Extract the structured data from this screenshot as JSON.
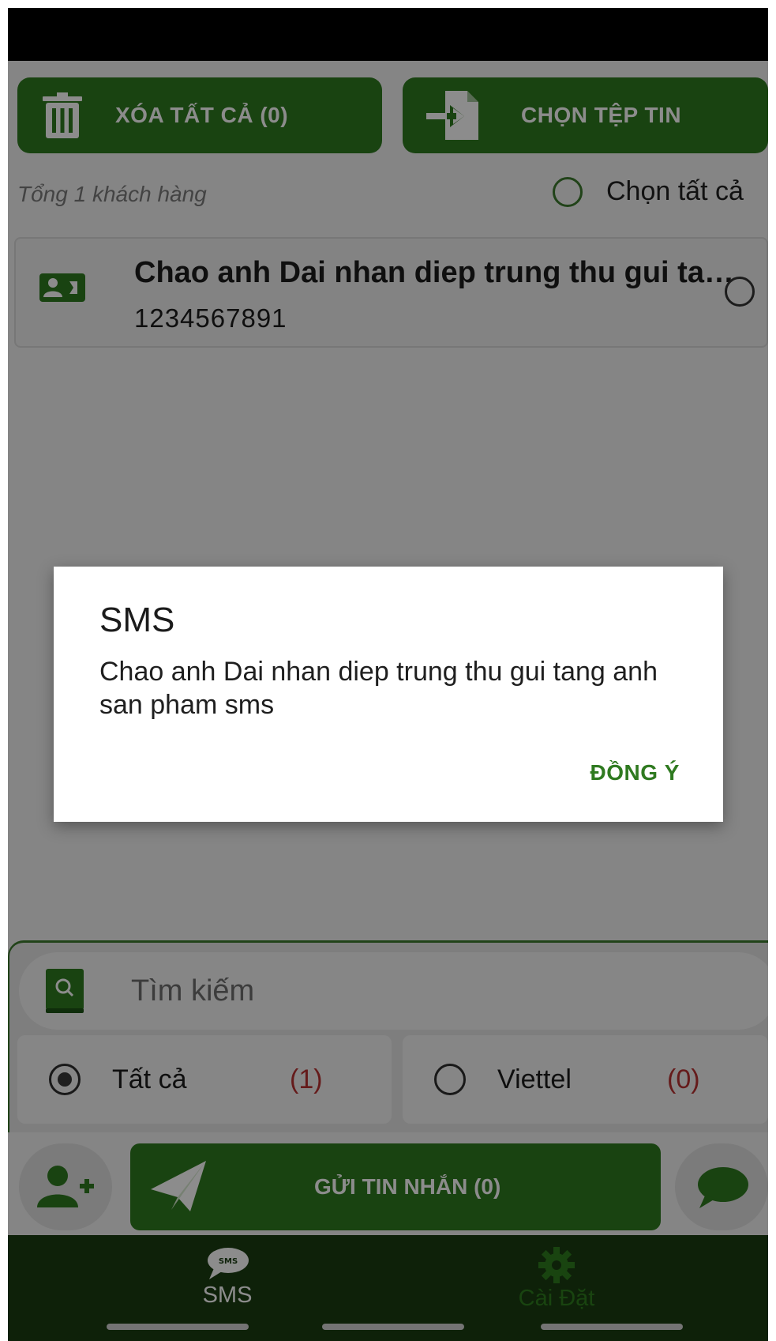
{
  "toolbar": {
    "delete_all_label": "XÓA TẤT CẢ (0)",
    "choose_file_label": "CHỌN TỆP TIN"
  },
  "list": {
    "total_text": "Tổng 1 khách hàng",
    "select_all_label": "Chọn tất cả",
    "items": [
      {
        "name": "Chao anh Dai nhan diep trung thu gui tang anh san pham sms",
        "phone": "1234567891"
      }
    ]
  },
  "search": {
    "placeholder": "Tìm kiếm"
  },
  "filters": [
    {
      "label": "Tất cả",
      "count": "(1)",
      "selected": true
    },
    {
      "label": "Viettel",
      "count": "(0)",
      "selected": false
    }
  ],
  "actions": {
    "send_label": "GỬI TIN NHẮN (0)"
  },
  "nav": {
    "sms_label": "SMS",
    "settings_label": "Cài Đặt",
    "sms_badge": "SMS"
  },
  "dialog": {
    "title": "SMS",
    "message": "Chao anh Dai nhan diep trung thu gui tang anh san pham sms",
    "ok_label": "ĐỒNG Ý"
  },
  "colors": {
    "primary": "#2f7a20",
    "nav_bg": "#1a3d12",
    "count_red": "#b83232"
  },
  "icons": {
    "delete": "trash-icon",
    "file": "file-import-icon",
    "contact": "contact-card-icon",
    "search": "search-book-icon",
    "add_user": "add-user-icon",
    "send": "paper-plane-icon",
    "chat": "chat-bubble-icon",
    "sms_nav": "sms-bubble-icon",
    "settings_nav": "gear-icon"
  }
}
